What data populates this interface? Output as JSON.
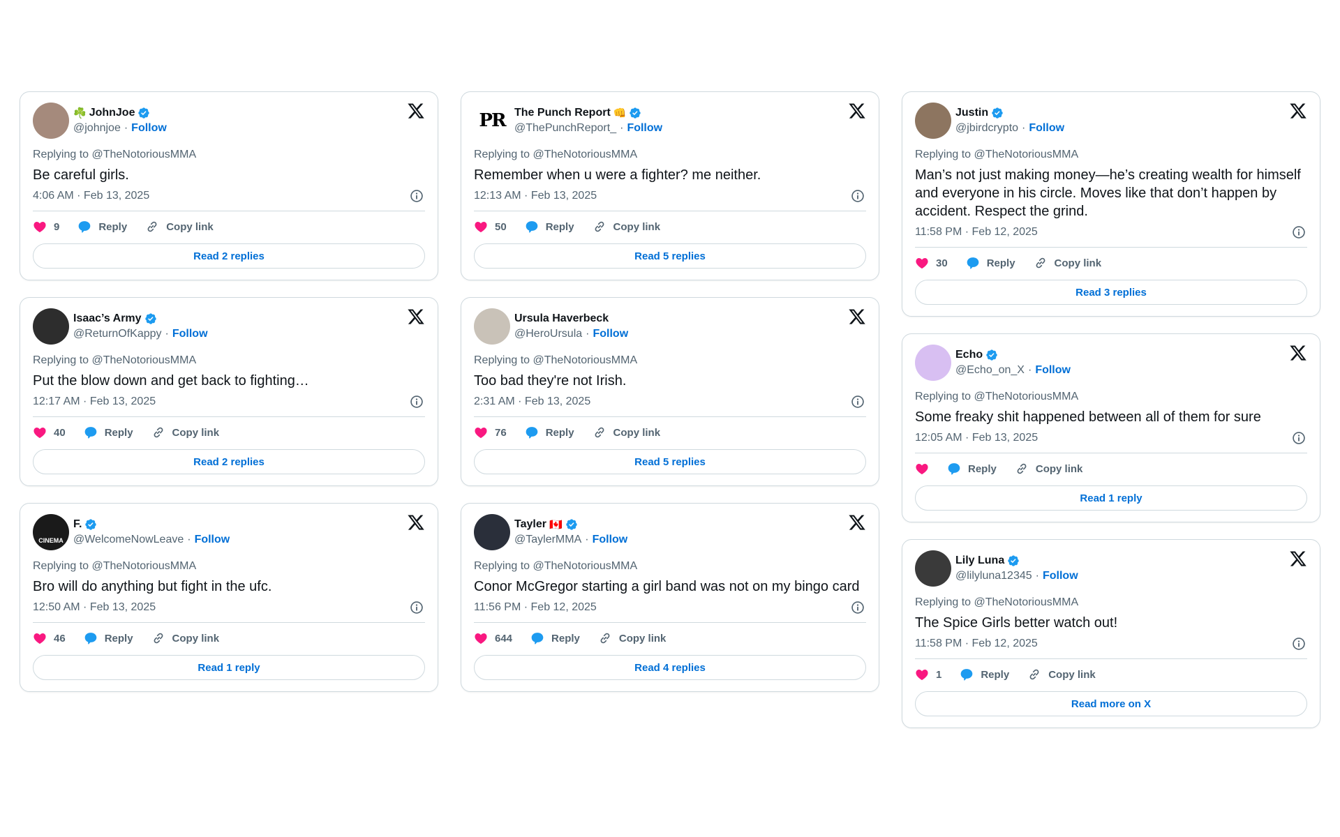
{
  "colors": {
    "heart": "#F91880",
    "reply": "#1D9BF0",
    "link_blue": "#006FD6",
    "muted": "#536471",
    "verified": "#1D9BF0"
  },
  "labels": {
    "reply": "Reply",
    "copy_link": "Copy link",
    "follow": "Follow",
    "separator": "·"
  },
  "columns": [
    [
      {
        "name": "JohnJoe",
        "name_prefix_emoji": "☘️",
        "name_suffix_emoji": "",
        "verified": true,
        "handle": "@johnjoe",
        "avatar": {
          "bg": "#a58a7c",
          "initials": ""
        },
        "replying_to": "Replying to @TheNotoriousMMA",
        "text": "Be careful girls.",
        "time": "4:06 AM · Feb 13, 2025",
        "likes": "9",
        "read_button": "Read 2 replies"
      },
      {
        "name": "Isaac’s Army",
        "name_prefix_emoji": "",
        "name_suffix_emoji": "",
        "verified": true,
        "handle": "@ReturnOfKappy",
        "avatar": {
          "bg": "#2d2d2d",
          "initials": ""
        },
        "replying_to": "Replying to @TheNotoriousMMA",
        "text": "Put the blow down and get back to fighting…",
        "time": "12:17 AM · Feb 13, 2025",
        "likes": "40",
        "read_button": "Read 2 replies"
      },
      {
        "name": "F.",
        "name_prefix_emoji": "",
        "name_suffix_emoji": "",
        "verified": true,
        "handle": "@WelcomeNowLeave",
        "avatar": {
          "bg": "#1a1a1a",
          "initials": "CINEMA"
        },
        "replying_to": "Replying to @TheNotoriousMMA",
        "text": "Bro will do anything but fight in the ufc.",
        "time": "12:50 AM · Feb 13, 2025",
        "likes": "46",
        "read_button": "Read 1 reply"
      }
    ],
    [
      {
        "name": "The Punch Report",
        "name_prefix_emoji": "",
        "name_suffix_emoji": "👊",
        "verified": true,
        "handle": "@ThePunchReport_",
        "avatar": {
          "bg": "#ffffff",
          "initials": "PR"
        },
        "replying_to": "Replying to @TheNotoriousMMA",
        "text": "Remember when u were a fighter? me neither.",
        "time": "12:13 AM · Feb 13, 2025",
        "likes": "50",
        "read_button": "Read 5 replies"
      },
      {
        "name": "Ursula Haverbeck",
        "name_prefix_emoji": "",
        "name_suffix_emoji": "",
        "verified": false,
        "handle": "@HeroUrsula",
        "avatar": {
          "bg": "#c9c2b8",
          "initials": ""
        },
        "replying_to": "Replying to @TheNotoriousMMA",
        "text": "Too bad they're not Irish.",
        "time": "2:31 AM · Feb 13, 2025",
        "likes": "76",
        "read_button": "Read 5 replies"
      },
      {
        "name": "Tayler",
        "name_prefix_emoji": "",
        "name_suffix_emoji": "🇨🇦",
        "verified": true,
        "handle": "@TaylerMMA",
        "avatar": {
          "bg": "#2a2f3a",
          "initials": ""
        },
        "replying_to": "Replying to @TheNotoriousMMA",
        "text": "Conor McGregor starting a girl band was not on my bingo card",
        "time": "11:56 PM · Feb 12, 2025",
        "likes": "644",
        "read_button": "Read 4 replies"
      }
    ],
    [
      {
        "name": "Justin",
        "name_prefix_emoji": "",
        "name_suffix_emoji": "",
        "verified": true,
        "handle": "@jbirdcrypto",
        "avatar": {
          "bg": "#8d7560",
          "initials": ""
        },
        "replying_to": "Replying to @TheNotoriousMMA",
        "text": "Man’s not just making money—he’s creating wealth for himself and everyone in his circle. Moves like that don’t happen by accident. Respect the grind.",
        "time": "11:58 PM · Feb 12, 2025",
        "likes": "30",
        "read_button": "Read 3 replies"
      },
      {
        "name": "Echo",
        "name_prefix_emoji": "",
        "name_suffix_emoji": "",
        "verified": true,
        "handle": "@Echo_on_X",
        "avatar": {
          "bg": "#d8bff2",
          "initials": ""
        },
        "replying_to": "Replying to @TheNotoriousMMA",
        "text": "Some freaky shit happened between all of them for sure",
        "time": "12:05 AM · Feb 13, 2025",
        "likes": "",
        "read_button": "Read 1 reply"
      },
      {
        "name": "Lily Luna",
        "name_prefix_emoji": "",
        "name_suffix_emoji": "",
        "verified": true,
        "handle": "@lilyluna12345",
        "avatar": {
          "bg": "#3a3a3a",
          "initials": ""
        },
        "replying_to": "Replying to @TheNotoriousMMA",
        "text": "The Spice Girls better watch out!",
        "time": "11:58 PM · Feb 12, 2025",
        "likes": "1",
        "read_button": "Read more on X"
      }
    ]
  ]
}
